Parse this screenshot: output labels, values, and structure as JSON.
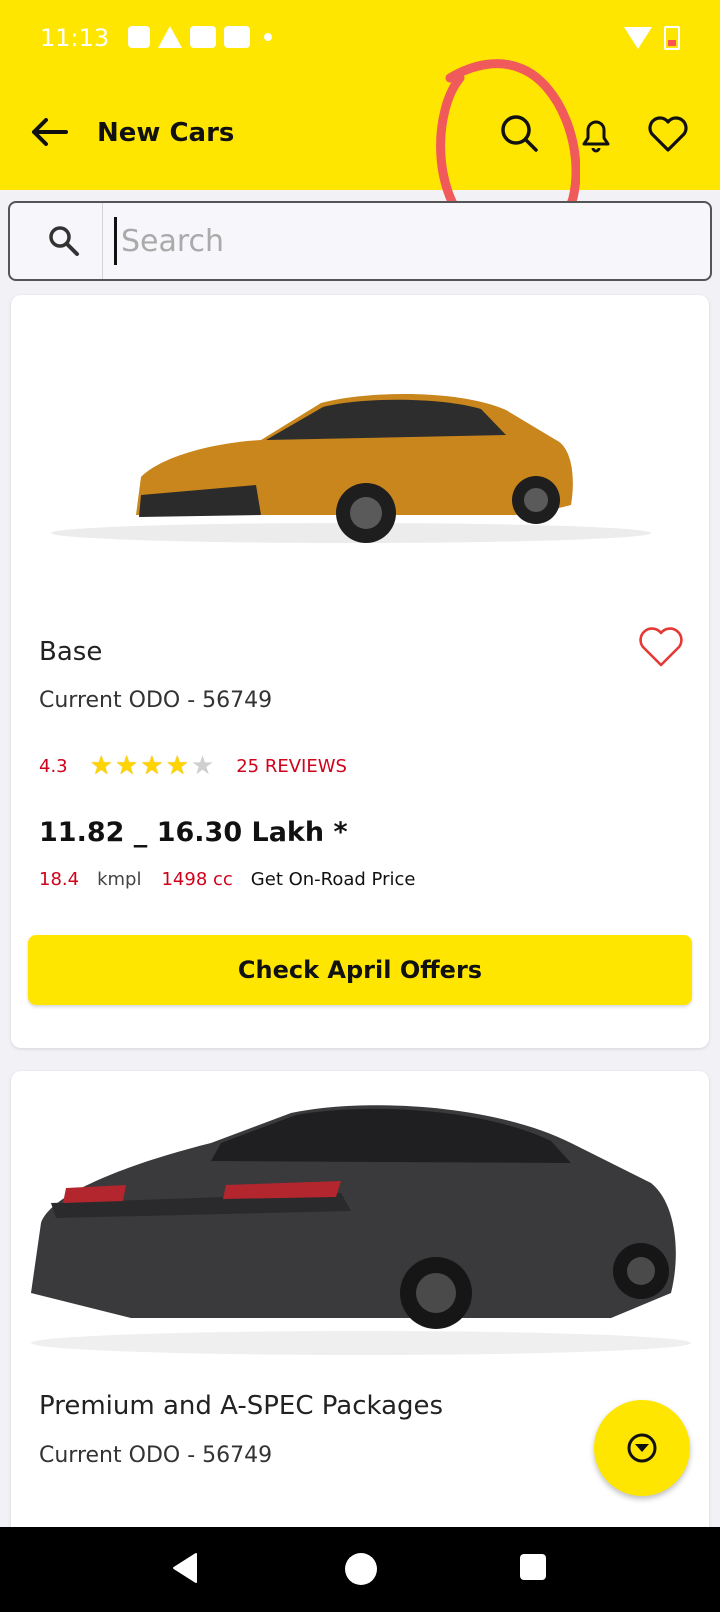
{
  "status_bar": {
    "time": "11:13"
  },
  "header": {
    "title": "New Cars"
  },
  "search": {
    "placeholder": "Search",
    "value": ""
  },
  "cars": [
    {
      "variant": "Base",
      "odo": "Current ODO - 56749",
      "rating": "4.3",
      "stars_filled": 4,
      "reviews": "25 REVIEWS",
      "price": "11.82 _ 16.30 Lakh *",
      "mileage_value": "18.4",
      "mileage_unit": "kmpl",
      "engine": "1498 cc",
      "onroad_link": "Get On-Road Price",
      "offers_button": "Check April Offers",
      "car_color": "#c8861c"
    },
    {
      "variant": "Premium and A-SPEC Packages",
      "odo": "Current ODO - 56749",
      "car_color": "#3a3a3c"
    }
  ],
  "colors": {
    "brand_yellow": "#ffe600",
    "accent_red": "#d0021b",
    "annotation_red": "#f05a5a"
  }
}
